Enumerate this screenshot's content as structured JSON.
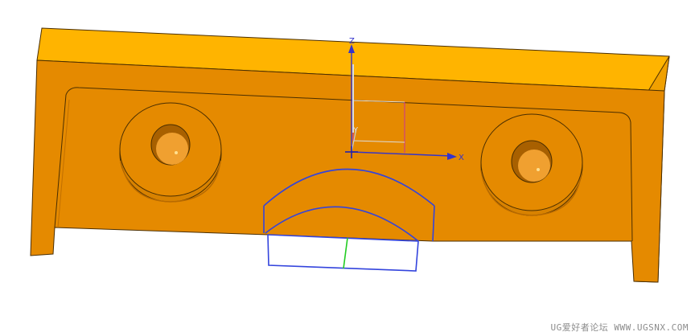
{
  "axes": {
    "x_label": "X",
    "y_label": "Y",
    "z_label": "Z",
    "x_color": "#3333cc",
    "z_color": "#3333cc"
  },
  "part": {
    "top_face_color": "#ffb400",
    "front_face_color": "#e58a00",
    "side_face_color": "#f0a000",
    "edge_color": "#4a2e00"
  },
  "sketch": {
    "curve_color": "#3344dd",
    "dimension_color": "#22cc22"
  },
  "watermark": "UG爱好者论坛 WWW.UGSNX.COM"
}
